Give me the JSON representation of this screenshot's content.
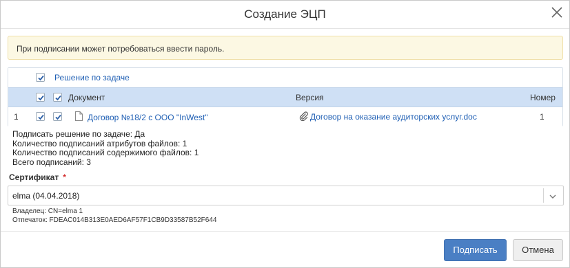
{
  "dialog": {
    "title": "Создание ЭЦП"
  },
  "warning": {
    "text": "При подписании может потребоваться ввести пароль."
  },
  "table": {
    "task_decision_label": "Решение по задаче",
    "columns": {
      "document": "Документ",
      "version": "Версия",
      "number": "Номер"
    },
    "rows": [
      {
        "index": "1",
        "document": "Договор №18/2 с ООО \"InWest\"",
        "version": "Договор на оказание аудиторских услуг.doc",
        "number": "1"
      }
    ]
  },
  "summary": {
    "line1": "Подписать решение по задаче: Да",
    "line2": "Количество подписаний атрибутов файлов: 1",
    "line3": "Количество подписаний содержимого файлов: 1",
    "line4": "Всего подписаний: 3"
  },
  "certificate": {
    "label": "Сертификат",
    "required_mark": "*",
    "value": "elma (04.04.2018)",
    "owner": "Владелец: CN=elma 1",
    "thumbprint": "Отпечаток: FDEAC014B313E0AED6AF57F1CB9D33587B52F644"
  },
  "buttons": {
    "sign": "Подписать",
    "cancel": "Отмена"
  },
  "colors": {
    "accent": "#4a7fc4",
    "link": "#1f5fb4",
    "header_row": "#cfe0f5",
    "warning_bg": "#fcf8e3"
  }
}
